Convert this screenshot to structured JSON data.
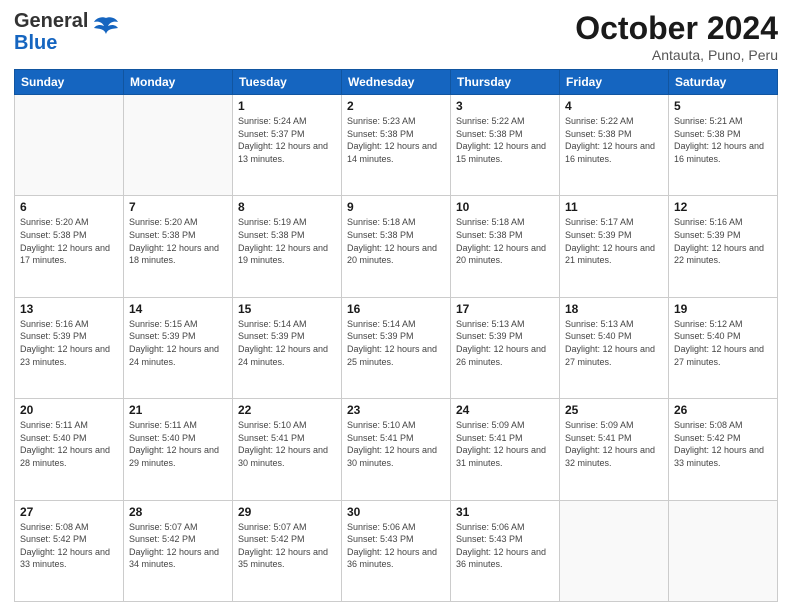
{
  "header": {
    "logo_general": "General",
    "logo_blue": "Blue",
    "title": "October 2024",
    "subtitle": "Antauta, Puno, Peru"
  },
  "calendar": {
    "days_of_week": [
      "Sunday",
      "Monday",
      "Tuesday",
      "Wednesday",
      "Thursday",
      "Friday",
      "Saturday"
    ],
    "weeks": [
      [
        {
          "day": "",
          "sunrise": "",
          "sunset": "",
          "daylight": ""
        },
        {
          "day": "",
          "sunrise": "",
          "sunset": "",
          "daylight": ""
        },
        {
          "day": "1",
          "sunrise": "Sunrise: 5:24 AM",
          "sunset": "Sunset: 5:37 PM",
          "daylight": "Daylight: 12 hours and 13 minutes."
        },
        {
          "day": "2",
          "sunrise": "Sunrise: 5:23 AM",
          "sunset": "Sunset: 5:38 PM",
          "daylight": "Daylight: 12 hours and 14 minutes."
        },
        {
          "day": "3",
          "sunrise": "Sunrise: 5:22 AM",
          "sunset": "Sunset: 5:38 PM",
          "daylight": "Daylight: 12 hours and 15 minutes."
        },
        {
          "day": "4",
          "sunrise": "Sunrise: 5:22 AM",
          "sunset": "Sunset: 5:38 PM",
          "daylight": "Daylight: 12 hours and 16 minutes."
        },
        {
          "day": "5",
          "sunrise": "Sunrise: 5:21 AM",
          "sunset": "Sunset: 5:38 PM",
          "daylight": "Daylight: 12 hours and 16 minutes."
        }
      ],
      [
        {
          "day": "6",
          "sunrise": "Sunrise: 5:20 AM",
          "sunset": "Sunset: 5:38 PM",
          "daylight": "Daylight: 12 hours and 17 minutes."
        },
        {
          "day": "7",
          "sunrise": "Sunrise: 5:20 AM",
          "sunset": "Sunset: 5:38 PM",
          "daylight": "Daylight: 12 hours and 18 minutes."
        },
        {
          "day": "8",
          "sunrise": "Sunrise: 5:19 AM",
          "sunset": "Sunset: 5:38 PM",
          "daylight": "Daylight: 12 hours and 19 minutes."
        },
        {
          "day": "9",
          "sunrise": "Sunrise: 5:18 AM",
          "sunset": "Sunset: 5:38 PM",
          "daylight": "Daylight: 12 hours and 20 minutes."
        },
        {
          "day": "10",
          "sunrise": "Sunrise: 5:18 AM",
          "sunset": "Sunset: 5:38 PM",
          "daylight": "Daylight: 12 hours and 20 minutes."
        },
        {
          "day": "11",
          "sunrise": "Sunrise: 5:17 AM",
          "sunset": "Sunset: 5:39 PM",
          "daylight": "Daylight: 12 hours and 21 minutes."
        },
        {
          "day": "12",
          "sunrise": "Sunrise: 5:16 AM",
          "sunset": "Sunset: 5:39 PM",
          "daylight": "Daylight: 12 hours and 22 minutes."
        }
      ],
      [
        {
          "day": "13",
          "sunrise": "Sunrise: 5:16 AM",
          "sunset": "Sunset: 5:39 PM",
          "daylight": "Daylight: 12 hours and 23 minutes."
        },
        {
          "day": "14",
          "sunrise": "Sunrise: 5:15 AM",
          "sunset": "Sunset: 5:39 PM",
          "daylight": "Daylight: 12 hours and 24 minutes."
        },
        {
          "day": "15",
          "sunrise": "Sunrise: 5:14 AM",
          "sunset": "Sunset: 5:39 PM",
          "daylight": "Daylight: 12 hours and 24 minutes."
        },
        {
          "day": "16",
          "sunrise": "Sunrise: 5:14 AM",
          "sunset": "Sunset: 5:39 PM",
          "daylight": "Daylight: 12 hours and 25 minutes."
        },
        {
          "day": "17",
          "sunrise": "Sunrise: 5:13 AM",
          "sunset": "Sunset: 5:39 PM",
          "daylight": "Daylight: 12 hours and 26 minutes."
        },
        {
          "day": "18",
          "sunrise": "Sunrise: 5:13 AM",
          "sunset": "Sunset: 5:40 PM",
          "daylight": "Daylight: 12 hours and 27 minutes."
        },
        {
          "day": "19",
          "sunrise": "Sunrise: 5:12 AM",
          "sunset": "Sunset: 5:40 PM",
          "daylight": "Daylight: 12 hours and 27 minutes."
        }
      ],
      [
        {
          "day": "20",
          "sunrise": "Sunrise: 5:11 AM",
          "sunset": "Sunset: 5:40 PM",
          "daylight": "Daylight: 12 hours and 28 minutes."
        },
        {
          "day": "21",
          "sunrise": "Sunrise: 5:11 AM",
          "sunset": "Sunset: 5:40 PM",
          "daylight": "Daylight: 12 hours and 29 minutes."
        },
        {
          "day": "22",
          "sunrise": "Sunrise: 5:10 AM",
          "sunset": "Sunset: 5:41 PM",
          "daylight": "Daylight: 12 hours and 30 minutes."
        },
        {
          "day": "23",
          "sunrise": "Sunrise: 5:10 AM",
          "sunset": "Sunset: 5:41 PM",
          "daylight": "Daylight: 12 hours and 30 minutes."
        },
        {
          "day": "24",
          "sunrise": "Sunrise: 5:09 AM",
          "sunset": "Sunset: 5:41 PM",
          "daylight": "Daylight: 12 hours and 31 minutes."
        },
        {
          "day": "25",
          "sunrise": "Sunrise: 5:09 AM",
          "sunset": "Sunset: 5:41 PM",
          "daylight": "Daylight: 12 hours and 32 minutes."
        },
        {
          "day": "26",
          "sunrise": "Sunrise: 5:08 AM",
          "sunset": "Sunset: 5:42 PM",
          "daylight": "Daylight: 12 hours and 33 minutes."
        }
      ],
      [
        {
          "day": "27",
          "sunrise": "Sunrise: 5:08 AM",
          "sunset": "Sunset: 5:42 PM",
          "daylight": "Daylight: 12 hours and 33 minutes."
        },
        {
          "day": "28",
          "sunrise": "Sunrise: 5:07 AM",
          "sunset": "Sunset: 5:42 PM",
          "daylight": "Daylight: 12 hours and 34 minutes."
        },
        {
          "day": "29",
          "sunrise": "Sunrise: 5:07 AM",
          "sunset": "Sunset: 5:42 PM",
          "daylight": "Daylight: 12 hours and 35 minutes."
        },
        {
          "day": "30",
          "sunrise": "Sunrise: 5:06 AM",
          "sunset": "Sunset: 5:43 PM",
          "daylight": "Daylight: 12 hours and 36 minutes."
        },
        {
          "day": "31",
          "sunrise": "Sunrise: 5:06 AM",
          "sunset": "Sunset: 5:43 PM",
          "daylight": "Daylight: 12 hours and 36 minutes."
        },
        {
          "day": "",
          "sunrise": "",
          "sunset": "",
          "daylight": ""
        },
        {
          "day": "",
          "sunrise": "",
          "sunset": "",
          "daylight": ""
        }
      ]
    ]
  }
}
